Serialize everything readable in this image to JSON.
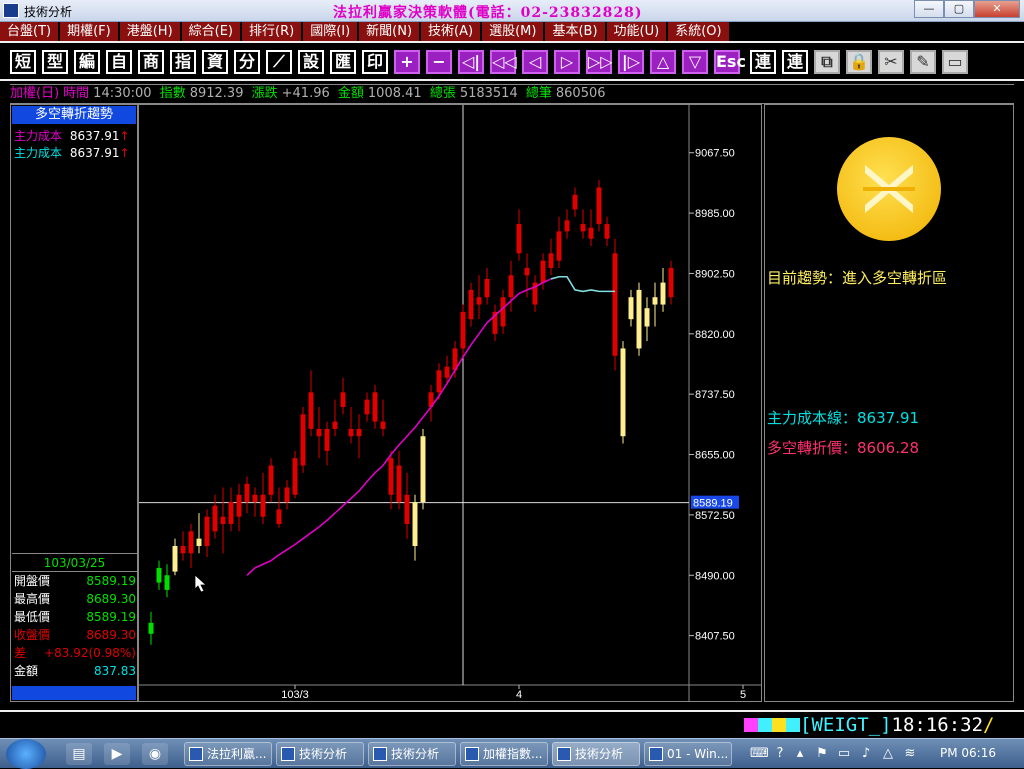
{
  "window": {
    "title": "技術分析",
    "banner": "法拉利贏家決策軟體(電話：02-23832828)",
    "min": "—",
    "max": "▢",
    "close": "✕"
  },
  "menu": [
    "台盤(T)",
    "期權(F)",
    "港盤(H)",
    "綜合(E)",
    "排行(R)",
    "國際(I)",
    "新聞(N)",
    "技術(A)",
    "選股(M)",
    "基本(B)",
    "功能(U)",
    "系統(O)"
  ],
  "toolbar": {
    "text_buttons": [
      "短",
      "型",
      "編",
      "自",
      "商",
      "指",
      "資",
      "分"
    ],
    "btn_trend": "⟋",
    "text_buttons2": [
      "設",
      "匯",
      "印"
    ],
    "nav": [
      "+",
      "−",
      "◁|",
      "◁◁",
      "◁",
      "▷",
      "▷▷",
      "|▷",
      "△",
      "▽",
      "Esc"
    ],
    "right": [
      "連",
      "連"
    ],
    "tools": [
      "⧉",
      "🔒",
      "✂",
      "✎",
      "▭"
    ]
  },
  "status": {
    "name": "加權(日)",
    "time_label": "時間",
    "time": "14:30:00",
    "index_label": "指數",
    "index": "8912.39",
    "change_label": "漲跌",
    "change": "+41.96",
    "amount_label": "金額",
    "amount": "1008.41",
    "vol_label": "總張",
    "vol": "5183514",
    "trades_label": "總筆",
    "trades": "860506"
  },
  "left": {
    "header": "多空轉折趨勢",
    "rows": [
      {
        "label": "主力成本",
        "value": "8637.91",
        "arrow": "↑",
        "color": "#e000c8"
      },
      {
        "label": "主力成本",
        "value": "8637.91",
        "arrow": "↑",
        "color": "#00e0e0"
      }
    ],
    "date": "103/03/25",
    "ohlc": [
      {
        "label": "開盤價",
        "value": "8589.19",
        "lc": "#ffffff",
        "vc": "#00e000"
      },
      {
        "label": "最高價",
        "value": "8689.30",
        "lc": "#ffffff",
        "vc": "#00e000"
      },
      {
        "label": "最低價",
        "value": "8589.19",
        "lc": "#ffffff",
        "vc": "#00e000"
      },
      {
        "label": "收盤價",
        "value": "8689.30",
        "lc": "#e00000",
        "vc": "#e00000"
      },
      {
        "label": "差",
        "value": "+83.92(0.98%)",
        "lc": "#e00000",
        "vc": "#e00000"
      },
      {
        "label": "金額",
        "value": "837.83",
        "lc": "#ffffff",
        "vc": "#00e0e0"
      }
    ]
  },
  "right": {
    "trend_label": "目前趨勢：進入多空轉折區",
    "cost_label": "主力成本線：",
    "cost_value": "8637.91",
    "turn_label": "多空轉折價：",
    "turn_value": "8606.28"
  },
  "chart_data": {
    "type": "candlestick",
    "y_ticks": [
      9067.5,
      8985.0,
      8902.5,
      8820.0,
      8737.5,
      8655.0,
      8572.5,
      8490.0,
      8407.5
    ],
    "y_tick_labels": [
      "9067.50",
      "8985.00",
      "8902.50",
      "8820.00",
      "8737.50",
      "8655.00",
      "8572.50",
      "8490.00",
      "8407.50"
    ],
    "ylim": [
      8340,
      9130
    ],
    "x_labels": [
      {
        "label": "103/3",
        "index": 18
      },
      {
        "label": "4",
        "index": 46
      },
      {
        "label": "5",
        "index": 74
      }
    ],
    "crosshair": {
      "index": 39,
      "price": 8589.19,
      "label": "8589.19"
    },
    "colors": {
      "up": "#e00000",
      "down_hl": "#ffef90",
      "green": "#00e000",
      "ma": "#e000c8",
      "ma_tail": "#80e0e0"
    },
    "candles": [
      {
        "o": 8410,
        "h": 8440,
        "l": 8395,
        "c": 8425,
        "t": "g"
      },
      {
        "o": 8480,
        "h": 8510,
        "l": 8470,
        "c": 8500,
        "t": "g"
      },
      {
        "o": 8470,
        "h": 8505,
        "l": 8460,
        "c": 8490,
        "t": "g"
      },
      {
        "o": 8495,
        "h": 8540,
        "l": 8490,
        "c": 8530,
        "t": "y"
      },
      {
        "o": 8530,
        "h": 8550,
        "l": 8510,
        "c": 8520,
        "t": "r"
      },
      {
        "o": 8520,
        "h": 8560,
        "l": 8500,
        "c": 8550,
        "t": "r"
      },
      {
        "o": 8540,
        "h": 8575,
        "l": 8520,
        "c": 8530,
        "t": "y"
      },
      {
        "o": 8530,
        "h": 8580,
        "l": 8515,
        "c": 8570,
        "t": "r"
      },
      {
        "o": 8550,
        "h": 8600,
        "l": 8540,
        "c": 8585,
        "t": "r"
      },
      {
        "o": 8560,
        "h": 8610,
        "l": 8520,
        "c": 8570,
        "t": "r"
      },
      {
        "o": 8590,
        "h": 8610,
        "l": 8550,
        "c": 8560,
        "t": "r"
      },
      {
        "o": 8570,
        "h": 8615,
        "l": 8550,
        "c": 8600,
        "t": "r"
      },
      {
        "o": 8590,
        "h": 8625,
        "l": 8575,
        "c": 8615,
        "t": "r"
      },
      {
        "o": 8590,
        "h": 8610,
        "l": 8570,
        "c": 8600,
        "t": "r"
      },
      {
        "o": 8600,
        "h": 8630,
        "l": 8560,
        "c": 8570,
        "t": "r"
      },
      {
        "o": 8600,
        "h": 8650,
        "l": 8590,
        "c": 8640,
        "t": "r"
      },
      {
        "o": 8560,
        "h": 8610,
        "l": 8555,
        "c": 8580,
        "t": "r"
      },
      {
        "o": 8590,
        "h": 8620,
        "l": 8580,
        "c": 8610,
        "t": "r"
      },
      {
        "o": 8600,
        "h": 8660,
        "l": 8595,
        "c": 8650,
        "t": "r"
      },
      {
        "o": 8640,
        "h": 8720,
        "l": 8630,
        "c": 8710,
        "t": "r"
      },
      {
        "o": 8690,
        "h": 8770,
        "l": 8680,
        "c": 8740,
        "t": "r"
      },
      {
        "o": 8690,
        "h": 8720,
        "l": 8650,
        "c": 8680,
        "t": "r"
      },
      {
        "o": 8660,
        "h": 8700,
        "l": 8640,
        "c": 8690,
        "t": "r"
      },
      {
        "o": 8700,
        "h": 8730,
        "l": 8680,
        "c": 8690,
        "t": "r"
      },
      {
        "o": 8720,
        "h": 8760,
        "l": 8710,
        "c": 8740,
        "t": "r"
      },
      {
        "o": 8690,
        "h": 8720,
        "l": 8670,
        "c": 8680,
        "t": "r"
      },
      {
        "o": 8680,
        "h": 8710,
        "l": 8650,
        "c": 8690,
        "t": "r"
      },
      {
        "o": 8710,
        "h": 8740,
        "l": 8700,
        "c": 8730,
        "t": "r"
      },
      {
        "o": 8700,
        "h": 8750,
        "l": 8690,
        "c": 8740,
        "t": "r"
      },
      {
        "o": 8690,
        "h": 8730,
        "l": 8680,
        "c": 8700,
        "t": "r"
      },
      {
        "o": 8600,
        "h": 8660,
        "l": 8580,
        "c": 8650,
        "t": "r"
      },
      {
        "o": 8640,
        "h": 8660,
        "l": 8580,
        "c": 8590,
        "t": "r"
      },
      {
        "o": 8600,
        "h": 8630,
        "l": 8540,
        "c": 8560,
        "t": "r"
      },
      {
        "o": 8530,
        "h": 8600,
        "l": 8510,
        "c": 8590,
        "t": "y"
      },
      {
        "o": 8590,
        "h": 8690,
        "l": 8580,
        "c": 8680,
        "t": "y"
      },
      {
        "o": 8720,
        "h": 8750,
        "l": 8700,
        "c": 8740,
        "t": "r"
      },
      {
        "o": 8740,
        "h": 8780,
        "l": 8730,
        "c": 8770,
        "t": "r"
      },
      {
        "o": 8760,
        "h": 8790,
        "l": 8750,
        "c": 8775,
        "t": "r"
      },
      {
        "o": 8770,
        "h": 8810,
        "l": 8760,
        "c": 8800,
        "t": "r"
      },
      {
        "o": 8800,
        "h": 8860,
        "l": 8790,
        "c": 8850,
        "t": "r"
      },
      {
        "o": 8840,
        "h": 8890,
        "l": 8830,
        "c": 8880,
        "t": "r"
      },
      {
        "o": 8860,
        "h": 8900,
        "l": 8840,
        "c": 8870,
        "t": "r"
      },
      {
        "o": 8870,
        "h": 8910,
        "l": 8860,
        "c": 8895,
        "t": "r"
      },
      {
        "o": 8820,
        "h": 8860,
        "l": 8810,
        "c": 8850,
        "t": "r"
      },
      {
        "o": 8830,
        "h": 8880,
        "l": 8820,
        "c": 8870,
        "t": "r"
      },
      {
        "o": 8870,
        "h": 8920,
        "l": 8850,
        "c": 8900,
        "t": "r"
      },
      {
        "o": 8930,
        "h": 8990,
        "l": 8920,
        "c": 8970,
        "t": "r"
      },
      {
        "o": 8900,
        "h": 8930,
        "l": 8870,
        "c": 8910,
        "t": "r"
      },
      {
        "o": 8860,
        "h": 8900,
        "l": 8850,
        "c": 8890,
        "t": "r"
      },
      {
        "o": 8890,
        "h": 8930,
        "l": 8880,
        "c": 8920,
        "t": "r"
      },
      {
        "o": 8910,
        "h": 8950,
        "l": 8900,
        "c": 8930,
        "t": "r"
      },
      {
        "o": 8920,
        "h": 8980,
        "l": 8910,
        "c": 8960,
        "t": "r"
      },
      {
        "o": 8960,
        "h": 8990,
        "l": 8950,
        "c": 8975,
        "t": "r"
      },
      {
        "o": 8990,
        "h": 9020,
        "l": 8980,
        "c": 9010,
        "t": "r"
      },
      {
        "o": 8960,
        "h": 8990,
        "l": 8950,
        "c": 8970,
        "t": "r"
      },
      {
        "o": 8950,
        "h": 8990,
        "l": 8940,
        "c": 8965,
        "t": "r"
      },
      {
        "o": 8970,
        "h": 9030,
        "l": 8960,
        "c": 9020,
        "t": "r"
      },
      {
        "o": 8950,
        "h": 8980,
        "l": 8940,
        "c": 8970,
        "t": "r"
      },
      {
        "o": 8930,
        "h": 8950,
        "l": 8770,
        "c": 8790,
        "t": "r"
      },
      {
        "o": 8800,
        "h": 8810,
        "l": 8670,
        "c": 8680,
        "t": "y"
      },
      {
        "o": 8840,
        "h": 8880,
        "l": 8830,
        "c": 8870,
        "t": "y"
      },
      {
        "o": 8800,
        "h": 8890,
        "l": 8790,
        "c": 8880,
        "t": "y"
      },
      {
        "o": 8830,
        "h": 8870,
        "l": 8810,
        "c": 8855,
        "t": "y"
      },
      {
        "o": 8860,
        "h": 8890,
        "l": 8830,
        "c": 8870,
        "t": "y"
      },
      {
        "o": 8860,
        "h": 8910,
        "l": 8850,
        "c": 8890,
        "t": "y"
      },
      {
        "o": 8870,
        "h": 8920,
        "l": 8860,
        "c": 8910,
        "t": "r"
      }
    ],
    "ma": [
      8490,
      8500,
      8505,
      8510,
      8518,
      8525,
      8532,
      8540,
      8548,
      8556,
      8565,
      8575,
      8585,
      8595,
      8605,
      8618,
      8630,
      8640,
      8655,
      8668,
      8680,
      8692,
      8706,
      8720,
      8735,
      8752,
      8770,
      8788,
      8805,
      8820,
      8835,
      8845,
      8855,
      8865,
      8875,
      8880,
      8884,
      8890,
      8895,
      8898,
      8898,
      8880,
      8878,
      8880,
      8878,
      8878,
      8878
    ]
  },
  "bottom": {
    "ticker": "[WEIGT_]",
    "time": "18:16:32",
    "slash": "/"
  },
  "taskbar": {
    "tasks": [
      "法拉利贏...",
      "技術分析",
      "技術分析",
      "加權指數...",
      "技術分析",
      "01 - Win..."
    ],
    "clock": "PM 06:16"
  }
}
